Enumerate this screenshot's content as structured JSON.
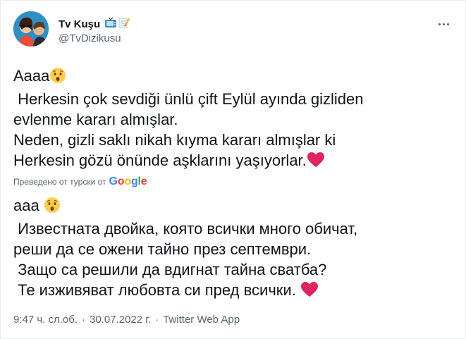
{
  "user": {
    "display_name": "Tv Kuşu",
    "handle": "@TvDizikusu",
    "badge_icons": [
      "tv-icon",
      "memo-icon"
    ]
  },
  "tweet": {
    "original_lines": [
      "Aaaa",
      " Herkesin çok sevdiği ünlü çift Eylül ayında gizliden",
      "evlenme kararı almışlar.",
      "Neden, gizli saklı nikah kıyma kararı almışlar ki",
      "Herkesin gözü önünde aşklarını yaşıyorlar."
    ],
    "translated_label": "Преведено от турски от",
    "translator": "Google",
    "translated_lines": [
      "ааа ",
      " Известната двойка, която всички много обичат,",
      "реши да се ожени тайно през септември.",
      " Защо са решили да вдигнат тайна сватба?",
      " Те изживяват любовта си пред всички. "
    ]
  },
  "footer": {
    "time": "9:47 ч. сл.об.",
    "date": "30.07.2022 г.",
    "separator": "·",
    "source": "Twitter Web App"
  },
  "colors": {
    "text": "#0f1419",
    "muted": "#536471",
    "heart": "#e0245e",
    "emoji_face": "#ffcc4d"
  }
}
